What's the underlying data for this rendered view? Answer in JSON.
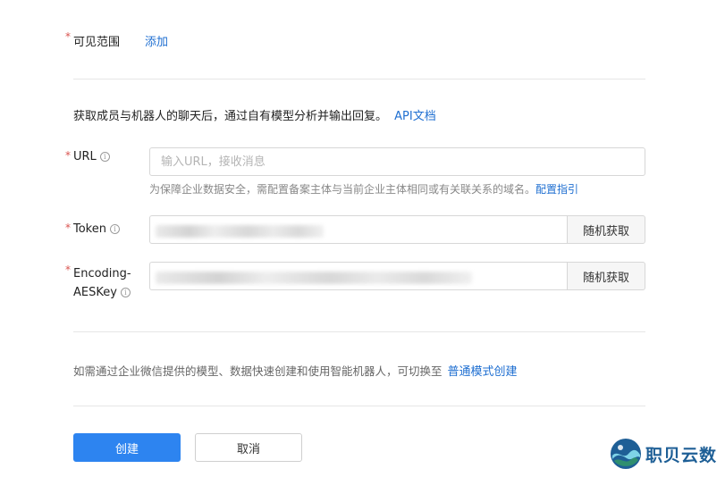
{
  "visibility": {
    "required_mark": "*",
    "label": "可见范围",
    "add_link": "添加"
  },
  "api_intro": {
    "text": "获取成员与机器人的聊天后，通过自有模型分析并输出回复。",
    "doc_link": "API文档"
  },
  "url_field": {
    "required_mark": "*",
    "label": "URL",
    "info_icon": "i",
    "placeholder": "输入URL，接收消息",
    "value": "",
    "hint": "为保障企业数据安全，需配置备案主体与当前企业主体相同或有关联关系的域名。",
    "hint_link": "配置指引"
  },
  "token_field": {
    "required_mark": "*",
    "label": "Token",
    "info_icon": "i",
    "random_button": "随机获取"
  },
  "aeskey_field": {
    "required_mark": "*",
    "label_line1": "Encoding-",
    "label_line2": "AESKey",
    "info_icon": "i",
    "random_button": "随机获取"
  },
  "switch_mode": {
    "text": "如需通过企业微信提供的模型、数据快速创建和使用智能机器人，可切换至",
    "link": "普通模式创建"
  },
  "actions": {
    "create": "创建",
    "cancel": "取消"
  },
  "watermark": {
    "text": "职贝云数"
  },
  "colors": {
    "accent": "#2d84f0",
    "link": "#1f6fd1",
    "required": "#d9534f"
  }
}
